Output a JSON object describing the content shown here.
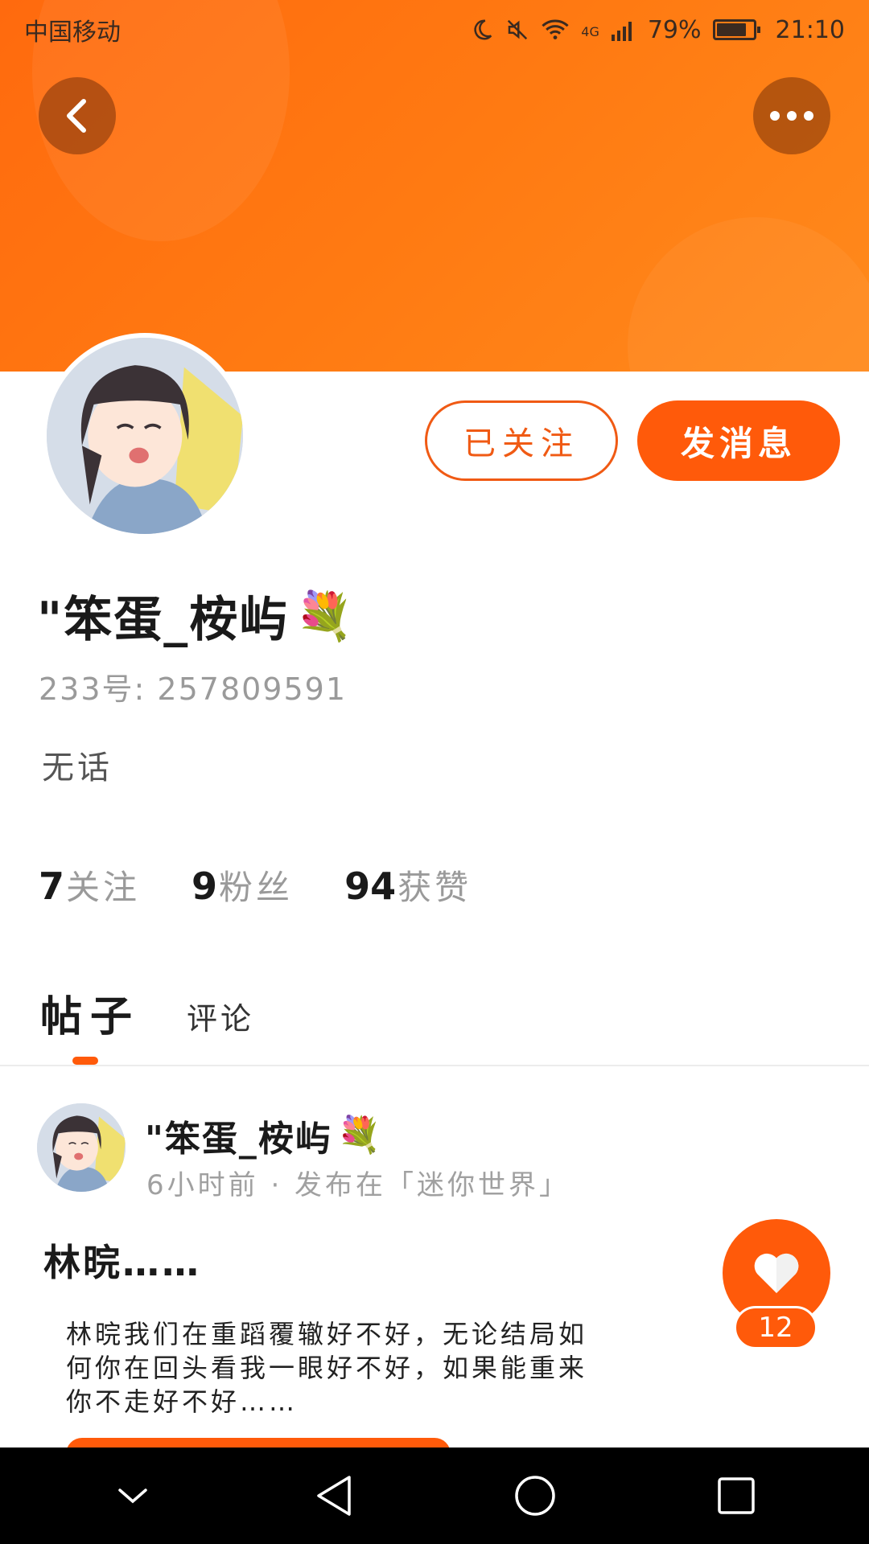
{
  "status_bar": {
    "carrier": "中国移动",
    "network": "4G",
    "battery_percent": "79%",
    "time": "21:10"
  },
  "profile": {
    "username": "\"笨蛋_桉屿",
    "user_id": "233号: 257809591",
    "bio": "无话",
    "follow_label": "已关注",
    "message_label": "发消息",
    "stats": [
      {
        "num": "7",
        "label": "关注"
      },
      {
        "num": "9",
        "label": "粉丝"
      },
      {
        "num": "94",
        "label": "获赞"
      }
    ]
  },
  "tabs": {
    "posts": "帖子",
    "comments": "评论"
  },
  "post": {
    "author": "\"笨蛋_桉屿",
    "meta": "6小时前 · 发布在「迷你世界」",
    "title": "林晥……",
    "body": "林晥我们在重蹈覆辙好不好，无论结局如何你在回头看我一眼好不好，如果能重来你不走好不好……",
    "like_count": "12"
  },
  "colors": {
    "accent": "#ff5a0a",
    "banner": "#ff7a12"
  },
  "icons": {
    "back": "chevron-left-icon",
    "more": "more-dots-icon",
    "like": "heart-icon",
    "flower": "💐"
  }
}
